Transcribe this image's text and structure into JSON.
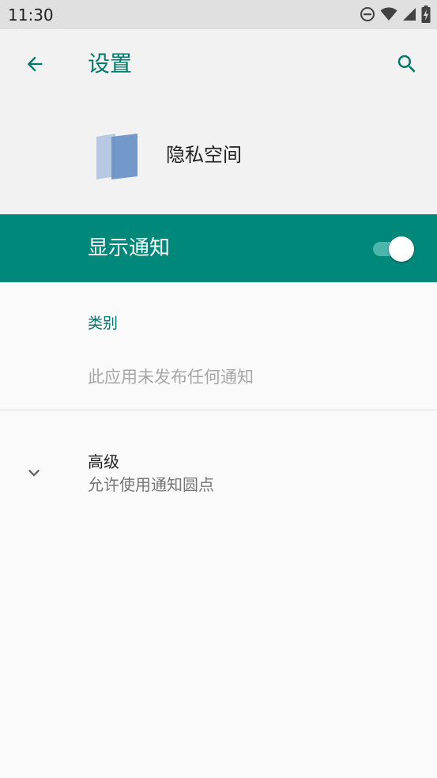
{
  "status_bar": {
    "time": "11:30",
    "icons": [
      "do-not-disturb-icon",
      "wifi-icon",
      "cellular-signal-icon",
      "battery-charging-icon"
    ]
  },
  "app_bar": {
    "title": "设置",
    "back_icon": "arrow-back-icon",
    "search_icon": "search-icon",
    "accent_color": "#00796b"
  },
  "app_header": {
    "app_name": "隐私空间",
    "app_icon": "private-space-icon"
  },
  "notification_toggle": {
    "label": "显示通知",
    "enabled": true,
    "background_color": "#00897b"
  },
  "categories": {
    "header": "类别",
    "empty_message": "此应用未发布任何通知"
  },
  "advanced": {
    "title": "高级",
    "summary": "允许使用通知圆点",
    "icon": "chevron-down-icon"
  }
}
